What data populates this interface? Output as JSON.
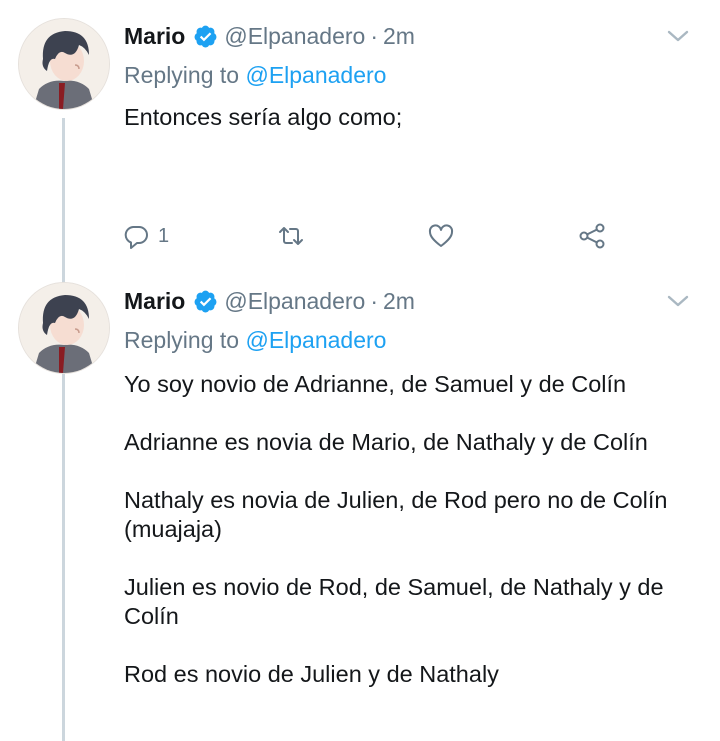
{
  "tweets": [
    {
      "name": "Mario",
      "handle": "@Elpanadero",
      "separator": "·",
      "time": "2m",
      "replying_prefix": "Replying to",
      "replying_to": "@Elpanadero",
      "paragraphs": [
        "Entonces sería algo como;"
      ],
      "reply_count": "1"
    },
    {
      "name": "Mario",
      "handle": "@Elpanadero",
      "separator": "·",
      "time": "2m",
      "replying_prefix": "Replying to",
      "replying_to": "@Elpanadero",
      "paragraphs": [
        "Yo soy novio de Adrianne, de Samuel y de Colín",
        "Adrianne es novia de Mario, de Nathaly y de Colín",
        "Nathaly es novia de Julien, de Rod pero no de Colín (muajaja)",
        "Julien es novio de Rod, de Samuel, de Nathaly y de Colín",
        "Rod es novio de Julien y de Nathaly"
      ]
    }
  ],
  "icons": {
    "verified": "verified-badge-icon",
    "caret": "chevron-down-icon",
    "reply": "reply-icon",
    "retweet": "retweet-icon",
    "like": "heart-icon",
    "share": "share-icon"
  },
  "colors": {
    "text": "#14171a",
    "muted": "#657786",
    "link": "#1da1f2",
    "verified": "#1da1f2",
    "thread_line": "#ccd6dd"
  }
}
